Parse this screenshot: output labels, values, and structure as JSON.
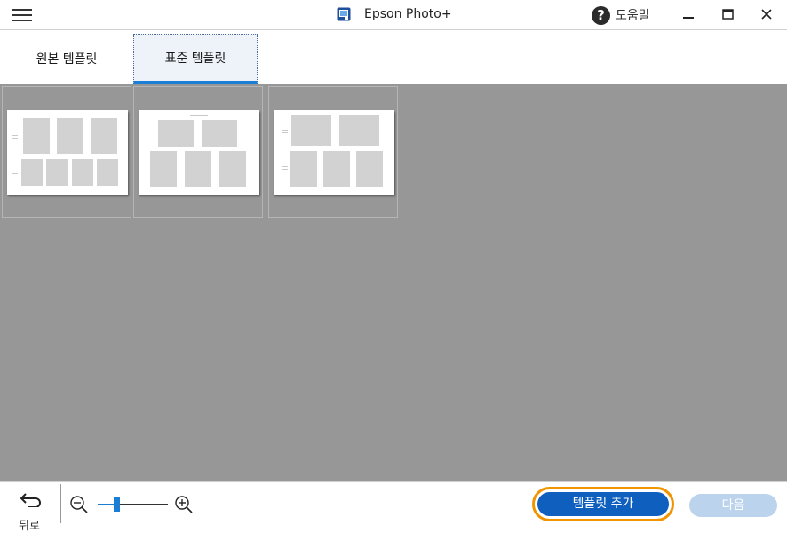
{
  "titlebar": {
    "app_title": "Epson Photo+",
    "app_icon": "epson-photo-app-icon",
    "help_label": "도움말",
    "help_icon": "question-circle-icon",
    "menu_icon": "hamburger-icon",
    "minimize_icon": "minimize-icon",
    "maximize_icon": "maximize-icon",
    "close_icon": "close-icon"
  },
  "tabs": [
    {
      "label": "원본 템플릿",
      "selected": false
    },
    {
      "label": "표준 템플릿",
      "selected": true
    }
  ],
  "templates": [
    {
      "name": "template-1",
      "selected": false
    },
    {
      "name": "template-2",
      "selected": false
    },
    {
      "name": "template-3",
      "selected": false
    }
  ],
  "bottombar": {
    "back_label": "뒤로",
    "back_icon": "undo-arrow-icon",
    "zoom_out_icon": "zoom-out-icon",
    "zoom_in_icon": "zoom-in-icon",
    "zoom_level": 0.25,
    "add_template_label": "템플릿 추가",
    "next_label": "다음",
    "next_enabled": false
  },
  "colors": {
    "accent": "#1a7fd4",
    "primary_button": "#0f5fbf",
    "highlight_ring": "#f09400",
    "disabled_button": "#bcd3ee",
    "canvas_background": "#979797"
  }
}
